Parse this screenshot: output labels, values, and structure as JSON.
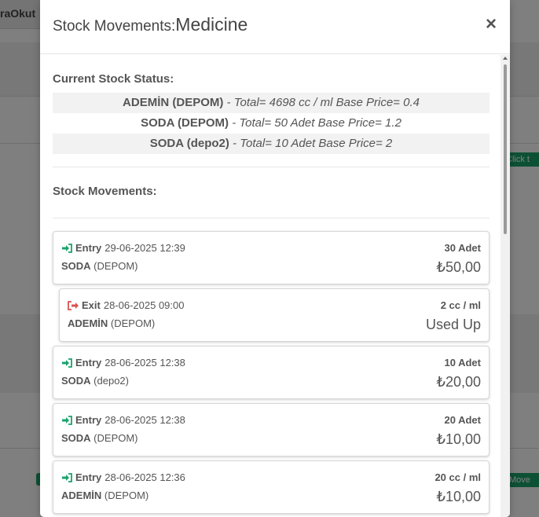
{
  "background": {
    "tab_label": "raOkut",
    "right_badge_1": "Click t",
    "right_badge_2": "Move"
  },
  "modal": {
    "title_prefix": "Stock Movements:",
    "title_item": "Medicine",
    "close_label": "×"
  },
  "current_status": {
    "title": "Current Stock Status:",
    "rows": [
      {
        "location": "ADEMİN (DEPOM)",
        "info": " - Total= 4698 cc / ml Base Price= 0.4"
      },
      {
        "location": "SODA (DEPOM)",
        "info": " - Total= 50 Adet Base Price= 1.2"
      },
      {
        "location": "SODA (depo2)",
        "info": " - Total= 10 Adet Base Price= 2"
      }
    ]
  },
  "movements": {
    "title": "Stock Movements:",
    "items": [
      {
        "kind": "entry",
        "type": "Entry",
        "datetime": "29-06-2025 12:39",
        "product": "SODA",
        "store": " (DEPOM)",
        "quantity": "30 Adet",
        "amount": "₺50,00"
      },
      {
        "kind": "exit",
        "type": "Exit",
        "datetime": "28-06-2025 09:00",
        "product": "ADEMİN",
        "store": " (DEPOM)",
        "quantity": "2 cc / ml",
        "amount": "Used Up"
      },
      {
        "kind": "entry",
        "type": "Entry",
        "datetime": "28-06-2025 12:38",
        "product": "SODA",
        "store": " (depo2)",
        "quantity": "10 Adet",
        "amount": "₺20,00"
      },
      {
        "kind": "entry",
        "type": "Entry",
        "datetime": "28-06-2025 12:38",
        "product": "SODA",
        "store": " (DEPOM)",
        "quantity": "20 Adet",
        "amount": "₺10,00"
      },
      {
        "kind": "entry",
        "type": "Entry",
        "datetime": "28-06-2025 12:36",
        "product": "ADEMİN",
        "store": " (DEPOM)",
        "quantity": "20 cc / ml",
        "amount": "₺10,00"
      }
    ]
  },
  "colors": {
    "entry_icon": "#1aa36b",
    "exit_icon": "#d9534f"
  }
}
